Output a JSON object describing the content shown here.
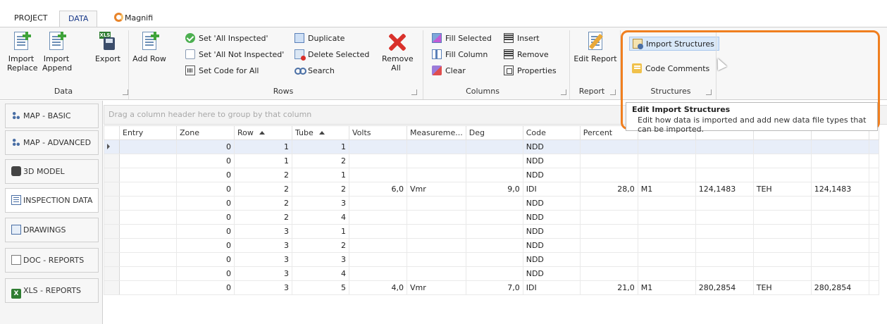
{
  "tabs": {
    "project": "PROJECT",
    "data": "DATA",
    "magnifi": "Magnifi"
  },
  "ribbon": {
    "data": {
      "import_replace": "Import\nReplace",
      "import_append": "Import\nAppend",
      "export": "Export",
      "group": "Data"
    },
    "rows": {
      "add_row": "Add Row",
      "set_all_inspected": "Set 'All Inspected'",
      "set_all_not_inspected": "Set 'All Not Inspected'",
      "set_code_for_all": "Set Code for All",
      "duplicate": "Duplicate",
      "delete_selected": "Delete Selected",
      "search": "Search",
      "remove_all": "Remove\nAll",
      "group": "Rows"
    },
    "columns": {
      "fill_selected": "Fill Selected",
      "fill_column": "Fill Column",
      "clear": "Clear",
      "insert": "Insert",
      "remove": "Remove",
      "properties": "Properties",
      "group": "Columns"
    },
    "report": {
      "edit_report": "Edit Report",
      "group": "Report"
    },
    "structures": {
      "import_structures": "Import Structures",
      "code_comments": "Code Comments",
      "group": "Structures"
    }
  },
  "tooltip": {
    "title": "Edit Import Structures",
    "body": "Edit how data is imported and add new data file types that can be imported."
  },
  "nav": {
    "items": [
      "MAP - BASIC",
      "MAP - ADVANCED",
      "3D MODEL",
      "INSPECTION DATA",
      "DRAWINGS",
      "DOC - REPORTS",
      "XLS - REPORTS"
    ],
    "active": "INSPECTION DATA"
  },
  "grid": {
    "group_hint": "Drag a column header here to group by that column",
    "columns": [
      "Entry",
      "Zone",
      "Row",
      "Tube",
      "Volts",
      "Measureme...",
      "Deg",
      "Code",
      "Percent",
      "",
      "",
      "",
      "",
      ""
    ],
    "rows": [
      [
        "",
        "0",
        "1",
        "1",
        "",
        "",
        "",
        "NDD",
        "",
        "",
        "",
        "",
        ""
      ],
      [
        "",
        "0",
        "1",
        "2",
        "",
        "",
        "",
        "NDD",
        "",
        "",
        "",
        "",
        ""
      ],
      [
        "",
        "0",
        "2",
        "1",
        "",
        "",
        "",
        "NDD",
        "",
        "",
        "",
        "",
        ""
      ],
      [
        "",
        "0",
        "2",
        "2",
        "6,0",
        "Vmr",
        "9,0",
        "IDI",
        "28,0",
        "M1",
        "124,1483",
        "TEH",
        "124,1483"
      ],
      [
        "",
        "0",
        "2",
        "3",
        "",
        "",
        "",
        "NDD",
        "",
        "",
        "",
        "",
        ""
      ],
      [
        "",
        "0",
        "2",
        "4",
        "",
        "",
        "",
        "NDD",
        "",
        "",
        "",
        "",
        ""
      ],
      [
        "",
        "0",
        "3",
        "1",
        "",
        "",
        "",
        "NDD",
        "",
        "",
        "",
        "",
        ""
      ],
      [
        "",
        "0",
        "3",
        "2",
        "",
        "",
        "",
        "NDD",
        "",
        "",
        "",
        "",
        ""
      ],
      [
        "",
        "0",
        "3",
        "3",
        "",
        "",
        "",
        "NDD",
        "",
        "",
        "",
        "",
        ""
      ],
      [
        "",
        "0",
        "3",
        "4",
        "",
        "",
        "",
        "NDD",
        "",
        "",
        "",
        "",
        ""
      ],
      [
        "",
        "0",
        "3",
        "5",
        "4,0",
        "Vmr",
        "7,0",
        "IDI",
        "21,0",
        "M1",
        "280,2854",
        "TEH",
        "280,2854"
      ]
    ]
  },
  "colors": {
    "highlight": "#f07f1f",
    "accent": "#1a3a8a"
  }
}
